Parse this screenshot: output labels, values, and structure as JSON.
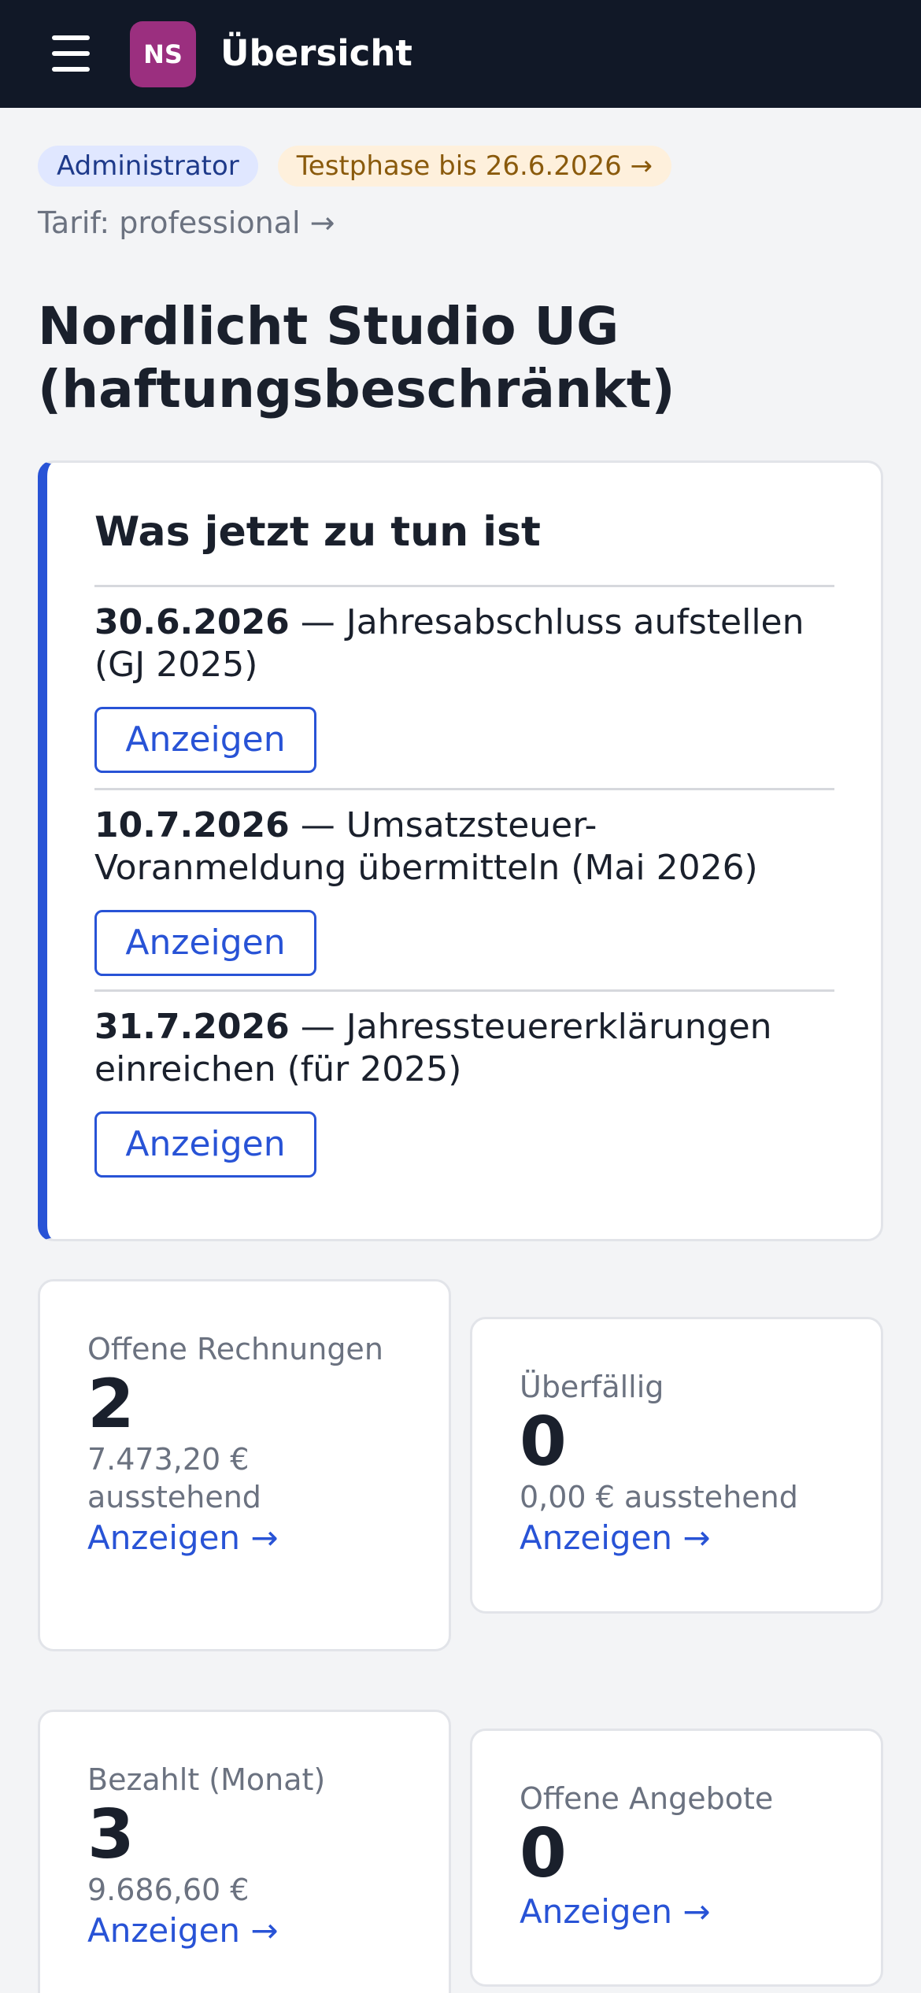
{
  "header": {
    "avatar_initials": "NS",
    "title": "Übersicht",
    "avatar_color": "#9b2f7f",
    "background": "#111827",
    "menu_icon": "hamburger-menu-icon"
  },
  "badges": {
    "role": "Administrator",
    "trial": "Testphase bis 26.6.2026 →"
  },
  "plan_link": "Tarif: professional →",
  "company_name": "Nordlicht Studio UG (haftungsbeschränkt)",
  "todo": {
    "title": "Was jetzt zu tun ist",
    "accent": "#2853d6",
    "items": [
      {
        "date": "30.6.2026",
        "text": " — Jahresabschluss aufstellen (GJ 2025)",
        "button": "Anzeigen"
      },
      {
        "date": "10.7.2026",
        "text": " — Umsatzsteuer-Voranmeldung übermitteln (Mai 2026)",
        "button": "Anzeigen"
      },
      {
        "date": "31.7.2026",
        "text": " — Jahressteuererklärungen einreichen (für 2025)",
        "button": "Anzeigen"
      }
    ]
  },
  "stats": {
    "open_invoices": {
      "label": "Offene Rechnungen",
      "value": "2",
      "sub": "7.473,20 € ausstehend",
      "link": "Anzeigen →"
    },
    "overdue": {
      "label": "Überfällig",
      "value": "0",
      "sub": "0,00 € ausstehend",
      "link": "Anzeigen →"
    },
    "paid_month": {
      "label": "Bezahlt (Monat)",
      "value": "3",
      "sub": "9.686,60 €",
      "link": "Anzeigen →"
    },
    "open_quotes": {
      "label": "Offene Angebote",
      "value": "0",
      "link": "Anzeigen →"
    }
  }
}
